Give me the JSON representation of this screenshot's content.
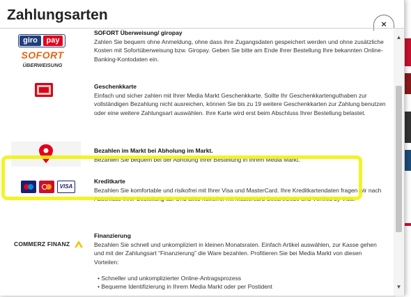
{
  "modal": {
    "title": "Zahlungsarten",
    "close_glyph": "×"
  },
  "scrollbar": {
    "up": "▲",
    "down": "▼"
  },
  "entries": [
    {
      "title": "SOFORT Überweisung/ giropay",
      "logo_giro": "giro",
      "logo_pay": "pay",
      "logo_sofort": "SOFORT",
      "logo_ueberweisung": "ÜBERWEISUNG",
      "desc": "Zahlen Sie bequem ohne Anmeldung, ohne dass ihre Zugangsdaten gespeichert werden und ohne zusätzliche Kosten mit Sofortüberweisung bzw. Giropay. Geben Sie bitte am Ende Ihrer Bestellung Ihre bekannten Online-Banking-Kontodaten ein."
    },
    {
      "title": "Geschenkkarte",
      "desc": "Einfach und sicher zahlen mit Ihrer Media Markt Geschenkkarte. Sollte Ihr Geschenkkartenguthaben zur vollständigen Bezahlung nicht ausreichen, können Sie bis zu 19 weitere Geschenkkarten zur Zahlung benutzen oder eine weitere Zahlungsart auswählen. Ihre Karte wird erst beim Abschluss Ihrer Bestellung belastet."
    },
    {
      "title": "Bezahlen im Markt bei Abholung im Markt.",
      "desc": "Bezahlen Sie bequem bei der Abholung Ihrer Bestellung in Ihrem Media Markt."
    },
    {
      "title": "Kreditkarte",
      "logo_visa": "VISA",
      "desc": "Bezahlen Sie komfortable und risikofrei mit Ihrer Visa und MasterCard. Ihre Kreditkartendaten fragen wir nach Abschluss Ihrer Bestellung ab. Und alles risikofrei mit Mastercard SecureCode und Verified by Visa."
    },
    {
      "title": "Finanzierung",
      "logo_text": "COMMERZ FINANZ",
      "desc": "Bezahlen Sie schnell und unkompliziert in kleinen Monatsraten. Einfach Artikel auswählen, zur Kasse gehen und mit der Zahlungsart “Finanzierung” die Ware bezahlen. Profitieren Sie bei Media Markt von diesen Vorteilen:",
      "bullets": [
        "Schneller und unkomplizierter Online-Antragsprozess",
        "Bequeme Identifizierung in Ihrem Media Markt oder per Postident"
      ]
    }
  ],
  "colors": {
    "highlight": "#f2f20f",
    "mm_red": "#d9001e"
  }
}
